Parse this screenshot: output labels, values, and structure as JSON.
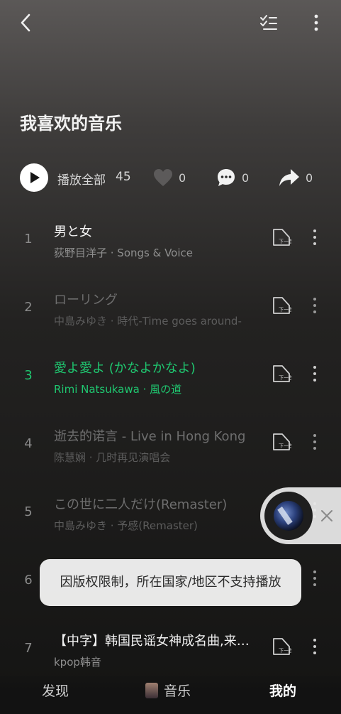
{
  "header": {
    "title": "我喜欢的音乐"
  },
  "actions": {
    "play_all_label": "播放全部",
    "play_count": "45",
    "likes": "0",
    "comments": "0",
    "shares": "0"
  },
  "songs": [
    {
      "index": "1",
      "title": "男と女",
      "subtitle": "荻野目洋子 · Songs & Voice",
      "state": "normal"
    },
    {
      "index": "2",
      "title": "ローリング",
      "subtitle": "中島みゆき · 時代-Time goes around-",
      "state": "dim"
    },
    {
      "index": "3",
      "title": "愛よ愛よ (かなよかなよ)",
      "subtitle": "Rimi Natsukawa · 風の道",
      "state": "active"
    },
    {
      "index": "4",
      "title": "逝去的诺言 - Live in Hong Kong",
      "subtitle": "陈慧娴 · 几时再见演唱会",
      "state": "dim"
    },
    {
      "index": "5",
      "title": "この世に二人だけ(Remaster)",
      "subtitle": "中島みゆき · 予感(Remaster)",
      "state": "dim"
    },
    {
      "index": "6",
      "title": "",
      "subtitle": "",
      "state": "dim"
    },
    {
      "index": "7",
      "title": "【中字】韩国民谣女神成名曲,来自...",
      "subtitle": "kpop韩音",
      "state": "normal"
    }
  ],
  "toast": {
    "message": "因版权限制，所在国家/地区不支持播放"
  },
  "bottom_nav": {
    "discover": "发现",
    "music": "音乐",
    "mine": "我的"
  },
  "colors": {
    "accent": "#1fc770",
    "background_top": "#5b5857",
    "background_bottom": "#141413"
  },
  "icons": [
    "back-icon",
    "multi-select-icon",
    "more-vertical-icon",
    "play-icon",
    "heart-icon",
    "comment-icon",
    "share-icon",
    "next-play-icon",
    "close-icon"
  ]
}
